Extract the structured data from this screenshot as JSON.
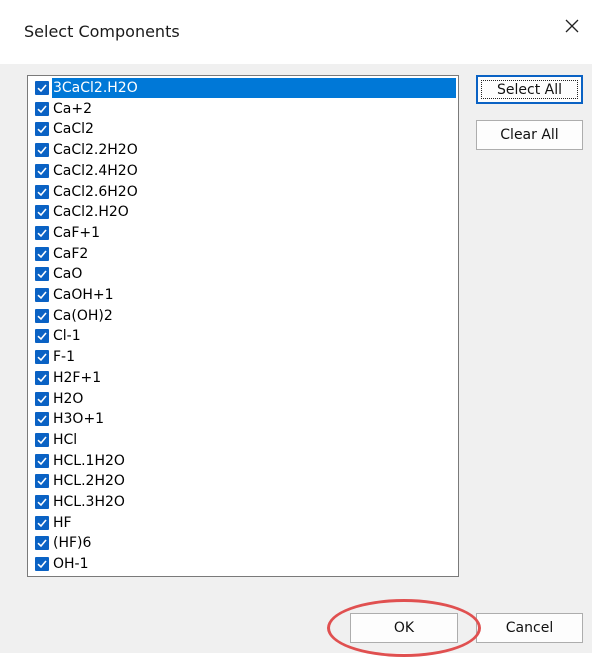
{
  "window": {
    "title": "Select Components"
  },
  "buttons": {
    "select_all": "Select All",
    "clear_all": "Clear All",
    "ok": "OK",
    "cancel": "Cancel"
  },
  "colors": {
    "accent": "#0078d7",
    "checkbox": "#0a62c4",
    "annotation_ring": "#e05050"
  },
  "components": [
    {
      "label": "3CaCl2.H2O",
      "checked": true,
      "selected": true
    },
    {
      "label": "Ca+2",
      "checked": true
    },
    {
      "label": "CaCl2",
      "checked": true
    },
    {
      "label": "CaCl2.2H2O",
      "checked": true
    },
    {
      "label": "CaCl2.4H2O",
      "checked": true
    },
    {
      "label": "CaCl2.6H2O",
      "checked": true
    },
    {
      "label": "CaCl2.H2O",
      "checked": true
    },
    {
      "label": "CaF+1",
      "checked": true
    },
    {
      "label": "CaF2",
      "checked": true
    },
    {
      "label": "CaO",
      "checked": true
    },
    {
      "label": "CaOH+1",
      "checked": true
    },
    {
      "label": "Ca(OH)2",
      "checked": true
    },
    {
      "label": "Cl-1",
      "checked": true
    },
    {
      "label": "F-1",
      "checked": true
    },
    {
      "label": "H2F+1",
      "checked": true
    },
    {
      "label": "H2O",
      "checked": true
    },
    {
      "label": "H3O+1",
      "checked": true
    },
    {
      "label": "HCl",
      "checked": true
    },
    {
      "label": "HCL.1H2O",
      "checked": true
    },
    {
      "label": "HCL.2H2O",
      "checked": true
    },
    {
      "label": "HCL.3H2O",
      "checked": true
    },
    {
      "label": "HF",
      "checked": true
    },
    {
      "label": "(HF)6",
      "checked": true
    },
    {
      "label": "OH-1",
      "checked": true
    }
  ]
}
